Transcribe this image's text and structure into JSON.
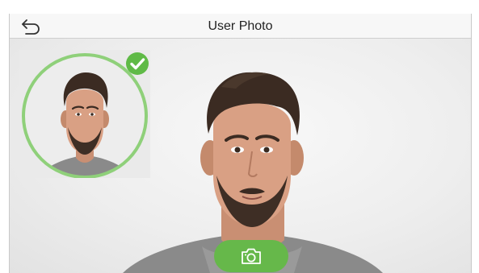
{
  "header": {
    "title": "User Photo",
    "back_icon": "back-arrow-icon"
  },
  "thumbnail": {
    "status_icon": "checkmark-icon",
    "status_color": "#5fba46",
    "ring_color": "#8fd07a"
  },
  "capture": {
    "icon": "camera-icon",
    "color": "#66b84a"
  }
}
